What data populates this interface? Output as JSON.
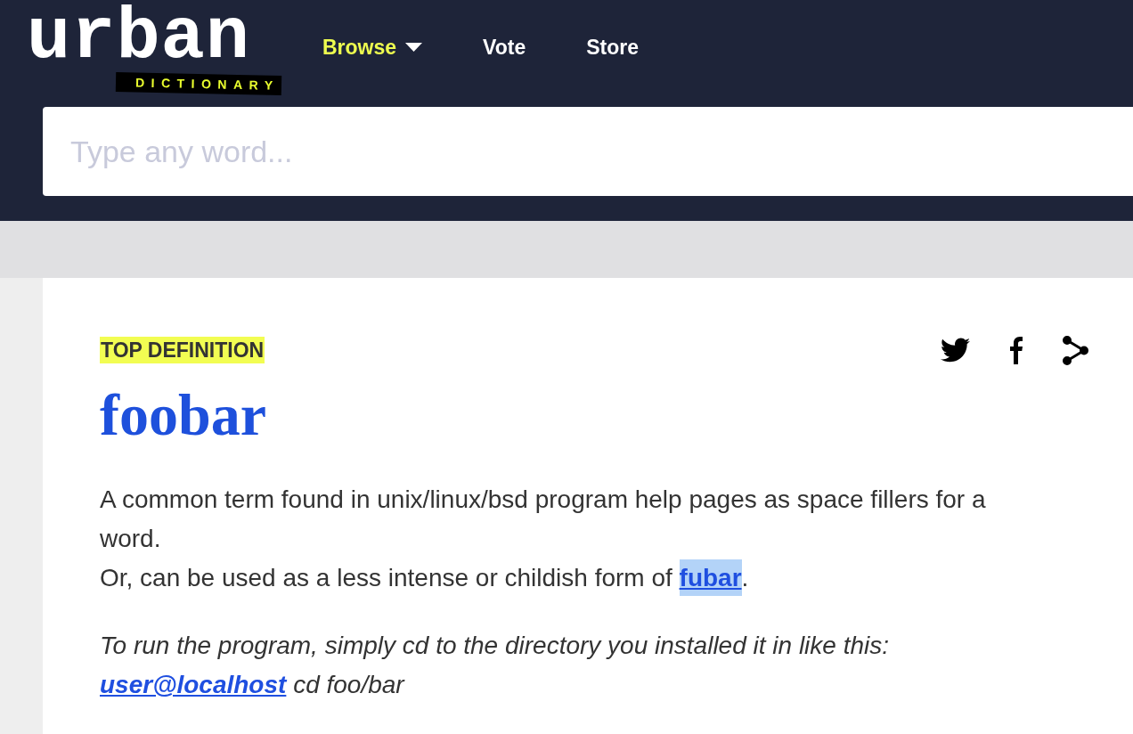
{
  "header": {
    "logo": {
      "wordmark": "urban",
      "tagline": "DICTIONARY"
    },
    "nav": [
      {
        "label": "Browse",
        "kind": "dropdown"
      },
      {
        "label": "Vote",
        "kind": "link"
      },
      {
        "label": "Store",
        "kind": "link"
      }
    ]
  },
  "search": {
    "placeholder": "Type any word..."
  },
  "definition": {
    "badge": "TOP DEFINITION",
    "word": "foobar",
    "share_buttons": [
      {
        "kind": "twitter"
      },
      {
        "kind": "facebook"
      },
      {
        "kind": "share"
      }
    ],
    "meaning": [
      {
        "parts": [
          {
            "kind": "text",
            "text": "A common term found in unix/linux/bsd program help pages as space fillers for a word."
          }
        ]
      },
      {
        "parts": [
          {
            "kind": "text",
            "text": "Or, can be used as a less intense or childish form of "
          },
          {
            "kind": "link",
            "text": "fubar",
            "highlighted": true
          },
          {
            "kind": "text",
            "text": "."
          }
        ]
      }
    ],
    "example": [
      {
        "parts": [
          {
            "kind": "text",
            "text": "To run the program, simply cd to the directory you installed it in like this:"
          }
        ]
      },
      {
        "parts": [
          {
            "kind": "link",
            "text": "user@localhost",
            "highlighted": false
          },
          {
            "kind": "text",
            "text": " cd foo/bar"
          }
        ]
      }
    ]
  }
}
